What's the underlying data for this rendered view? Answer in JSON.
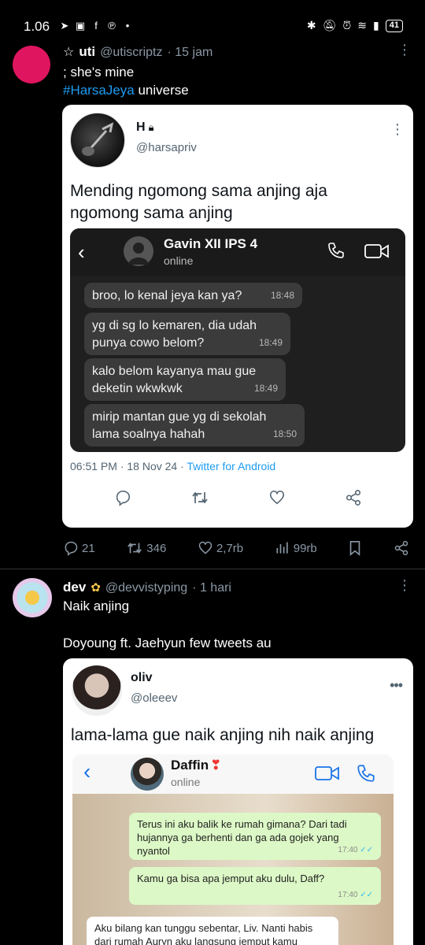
{
  "status_bar": {
    "time": "1.06",
    "battery": "41"
  },
  "tweet1": {
    "display_name": "uti",
    "handle": "@utiscriptz",
    "time_ago": "· 15 jam",
    "line1": "; she's mine",
    "hashtag": "#HarsaJeya",
    "hashtag_suffix": " universe",
    "quote": {
      "display_name": "H",
      "handle": "@harsapriv",
      "text": "Mending ngomong sama anjing aja ngomong sama anjing",
      "chat": {
        "contact_name": "Gavin XII IPS 4",
        "status": "online",
        "messages": [
          {
            "text": "broo, lo kenal jeya kan ya?",
            "time": "18:48"
          },
          {
            "text": "yg di sg lo kemaren, dia udah punya cowo belom?",
            "time": "18:49"
          },
          {
            "text": "kalo belom kayanya mau gue deketin wkwkwk",
            "time": "18:49"
          },
          {
            "text": "mirip mantan gue yg di sekolah lama soalnya hahah",
            "time": "18:50"
          }
        ]
      },
      "timestamp": "06:51 PM · 18 Nov 24 ·",
      "source": "Twitter for Android"
    },
    "stats": {
      "replies": "21",
      "retweets": "346",
      "likes": "2,7rb",
      "views": "99rb"
    }
  },
  "tweet2": {
    "display_name": "dev",
    "handle": "@devvistyping",
    "time_ago": "· 1 hari",
    "line1": "Naik anjing",
    "line2": "Doyoung ft. Jaehyun few tweets au",
    "quote": {
      "display_name": "oliv",
      "handle": "@oleeev",
      "text": "lama-lama gue naik anjing nih naik anjing",
      "chat": {
        "contact_name": "Daffin",
        "status": "online",
        "messages": [
          {
            "text": "Terus ini aku balik ke rumah gimana? Dari tadi hujannya ga berhenti dan ga ada gojek yang nyantol",
            "time": "17:40"
          },
          {
            "text": "Kamu ga bisa apa jemput aku dulu, Daff?",
            "time": "17:40"
          },
          {
            "text": "Aku bilang kan tunggu sebentar, Liv. Nanti habis dari rumah Auryn aku langsung jemput kamu"
          }
        ]
      }
    }
  },
  "colors": {
    "link": "#1d9bf0",
    "uti_avatar": "#e0155f",
    "dark_bg": "#000000"
  }
}
